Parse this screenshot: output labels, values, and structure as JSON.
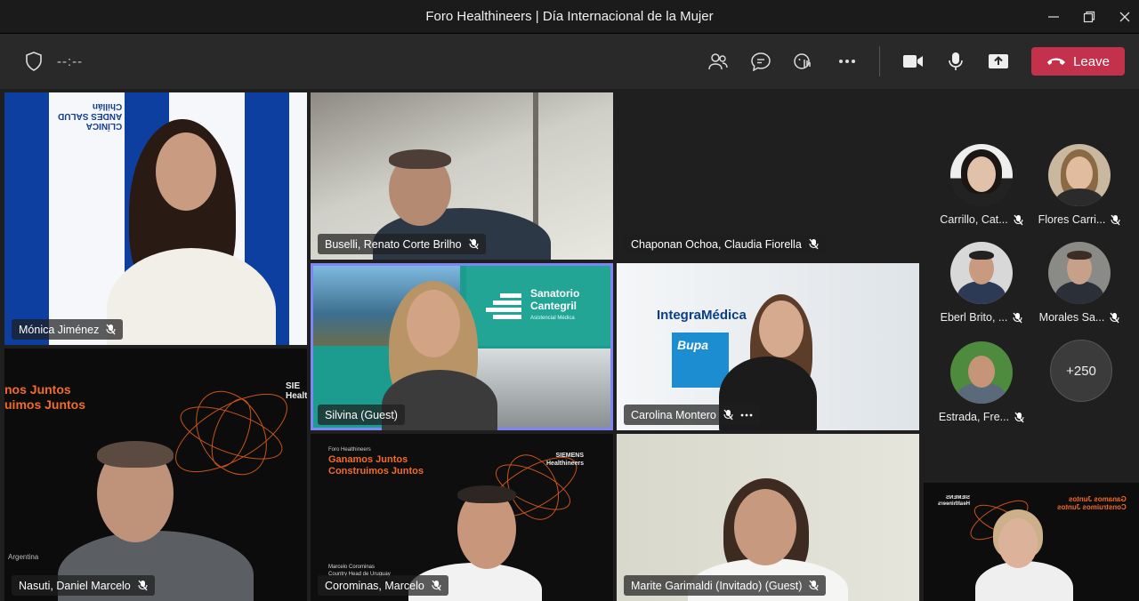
{
  "window": {
    "title": "Foro Healthineers | Día Internacional de la Mujer"
  },
  "toolbar": {
    "timer": "--:--",
    "leave_label": "Leave"
  },
  "tiles": {
    "monica": {
      "name": "Mónica Jiménez",
      "bg_text": [
        "CLÍNICA",
        "ANDES SALUD",
        "Chillán"
      ]
    },
    "buselli": {
      "name": "Buselli, Renato Corte Brilho"
    },
    "chaponan": {
      "name": "Chaponan Ochoa, Claudia Fiorella"
    },
    "silvina": {
      "name": "Silvina (Guest)",
      "banner_title": "Sanatorio",
      "banner_title2": "Cantegril",
      "banner_sub": "Asistencial Médica"
    },
    "carolina": {
      "name": "Carolina Montero",
      "banner": "IntegraMédica",
      "logo": "Bupa"
    },
    "nasuti": {
      "name": "Nasuti, Daniel Marcelo",
      "line1": "nos Juntos",
      "line2": "uimos Juntos",
      "brand": "SIE",
      "brand2": "Healthi",
      "footer": "Argentina"
    },
    "corominas": {
      "name": "Corominas, Marcelo",
      "kicker": "Foro Healthineers",
      "line1": "Ganamos Juntos",
      "line2": "Construimos Juntos",
      "brand": "SIEMENS",
      "brand2": "Healthineers",
      "person": "Marcelo Corominas",
      "role": "Country Head de Uruguay"
    },
    "marite": {
      "name": "Marite Garimaldi (Invitado) (Guest)"
    },
    "corner": {
      "line1": "Ganamos Juntos",
      "line2": "Construimos Juntos",
      "brand": "SIEMENS",
      "brand2": "Healthineers"
    }
  },
  "roster": [
    {
      "name": "Carrillo, Cat..."
    },
    {
      "name": "Flores Carri..."
    },
    {
      "name": "Eberl Brito, ..."
    },
    {
      "name": "Morales Sa..."
    },
    {
      "name": "Estrada, Fre..."
    }
  ],
  "overflow_count": "+250",
  "colors": {
    "leave": "#c4314b",
    "selected_outline": "#7f85f5",
    "siemens_orange": "#f26b2a"
  }
}
